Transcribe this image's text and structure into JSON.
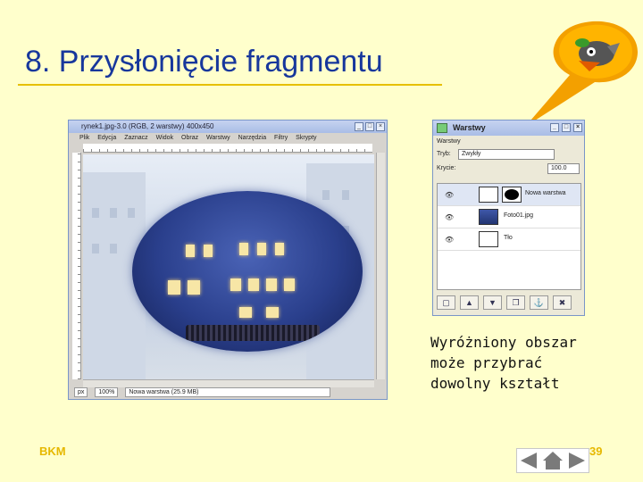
{
  "slide": {
    "title": "8. Przysłonięcie fragmentu",
    "caption_lines": [
      "Wyróżniony obszar",
      "może przybrać",
      "dowolny kształt"
    ],
    "footer_left": "BKM",
    "page_number": "39",
    "accent_color": "#17379c",
    "footer_color": "#e6b800"
  },
  "image_window": {
    "title": "rynek1.jpg-3.0 (RGB, 2 warstwy) 400x450",
    "menu": [
      "Plik",
      "Edycja",
      "Zaznacz",
      "Widok",
      "Obraz",
      "Warstwy",
      "Narzędzia",
      "Filtry",
      "Skrypty"
    ],
    "status": {
      "unit": "px",
      "zoom": "100%",
      "info": "Nowa warstwa (25.9 MB)"
    },
    "controls": [
      "_",
      "□",
      "×"
    ]
  },
  "layers_dialog": {
    "title": "Warstwy",
    "section_label": "Warstwy",
    "mode_label": "Tryb:",
    "mode_value": "Zwykły",
    "opacity_label": "Krycie:",
    "opacity_value": "100.0",
    "controls": [
      "_",
      "□",
      "×"
    ],
    "layers": [
      {
        "name": "Nowa warstwa",
        "icon": "eye-icon",
        "selected": true
      },
      {
        "name": "Foto01.jpg",
        "icon": "eye-icon",
        "selected": false
      },
      {
        "name": "Tło",
        "icon": "eye-icon",
        "selected": false
      }
    ],
    "tool_icons": [
      "new-layer-icon",
      "raise-icon",
      "lower-icon",
      "duplicate-icon",
      "anchor-icon",
      "delete-icon"
    ]
  },
  "navigation": {
    "icons": [
      "prev-arrow-icon",
      "home-icon",
      "next-arrow-icon"
    ]
  }
}
